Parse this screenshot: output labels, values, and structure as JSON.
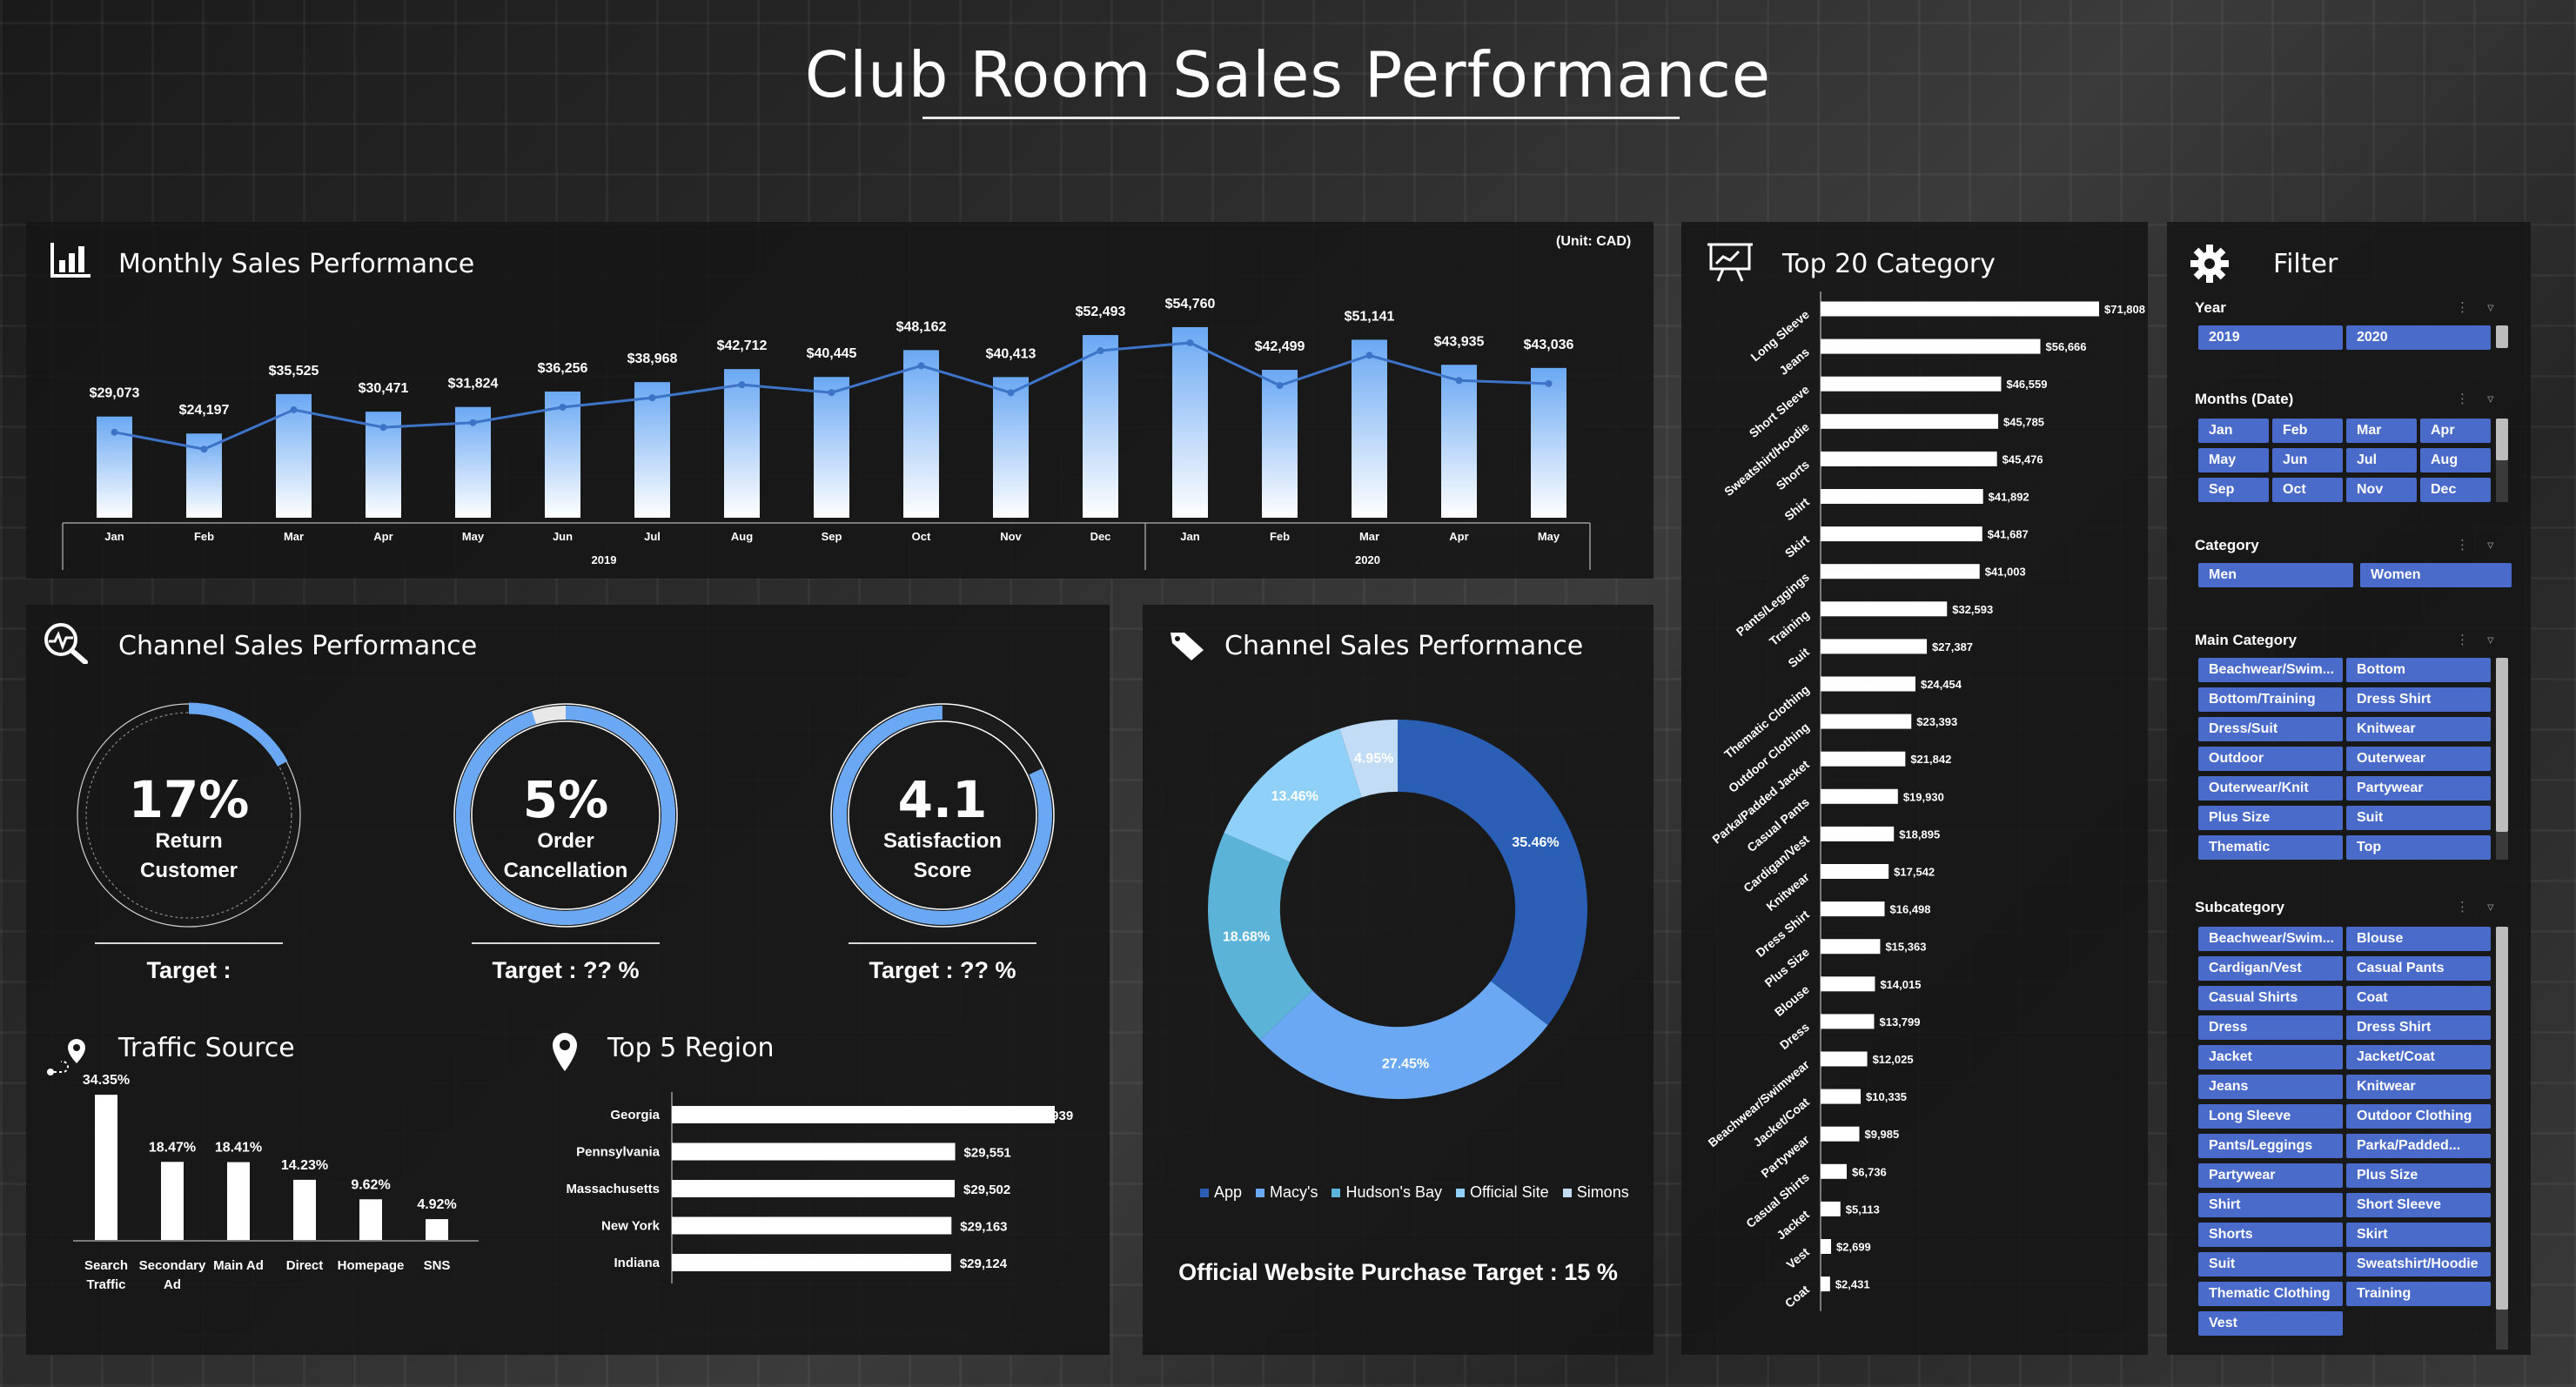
{
  "title": "Club Room Sales Performance",
  "colors": {
    "bar_light": "#ffffff",
    "bar_blue": "#6aa8f3",
    "line_blue": "#3d74c8",
    "chip": "#4a6bc9",
    "donut": [
      "#2a5fb5",
      "#6aa8f3",
      "#5bb4d8",
      "#8fd0f8",
      "#c2dcf6"
    ]
  },
  "monthly": {
    "title": "Monthly Sales Performance",
    "unit": "(Unit: CAD)",
    "icon": "bar-chart-icon"
  },
  "channel_kpi": {
    "title": "Channel Sales Performance",
    "icon": "chart-search-icon",
    "kpis": [
      {
        "big": "17%",
        "line1": "Return",
        "line2": "Customer",
        "target": "Target :",
        "fill": 0.17
      },
      {
        "big": "5%",
        "line1": "Order",
        "line2": "Cancellation",
        "target": "Target : ?? %",
        "fill": 0.95
      },
      {
        "big": "4.1",
        "line1": "Satisfaction",
        "line2": "Score",
        "target": "Target : ?? %",
        "fill": 0.82
      }
    ]
  },
  "traffic": {
    "title": "Traffic Source",
    "icon": "location-route-icon"
  },
  "region": {
    "title": "Top 5 Region",
    "icon": "map-pin-icon"
  },
  "channel_donut": {
    "title": "Channel Sales Performance",
    "icon": "tag-icon",
    "target_text": "Official Website Purchase Target : 15 %"
  },
  "top20": {
    "title": "Top 20 Category",
    "icon": "presentation-icon"
  },
  "filter": {
    "title": "Filter",
    "icon": "gear-icon",
    "year": {
      "label": "Year",
      "items": [
        "2019",
        "2020"
      ]
    },
    "months": {
      "label": "Months (Date)",
      "items": [
        "Jan",
        "Feb",
        "Mar",
        "Apr",
        "May",
        "Jun",
        "Jul",
        "Aug",
        "Sep",
        "Oct",
        "Nov",
        "Dec"
      ]
    },
    "category": {
      "label": "Category",
      "items": [
        "Men",
        "Women"
      ]
    },
    "main_category": {
      "label": "Main Category",
      "items": [
        "Beachwear/Swim...",
        "Bottom",
        "Bottom/Training",
        "Dress Shirt",
        "Dress/Suit",
        "Knitwear",
        "Outdoor",
        "Outerwear",
        "Outerwear/Knit",
        "Partywear",
        "Plus Size",
        "Suit",
        "Thematic",
        "Top"
      ]
    },
    "subcategory": {
      "label": "Subcategory",
      "items": [
        "Beachwear/Swim...",
        "Blouse",
        "Cardigan/Vest",
        "Casual Pants",
        "Casual Shirts",
        "Coat",
        "Dress",
        "Dress Shirt",
        "Jacket",
        "Jacket/Coat",
        "Jeans",
        "Knitwear",
        "Long Sleeve",
        "Outdoor Clothing",
        "Pants/Leggings",
        "Parka/Padded...",
        "Partywear",
        "Plus Size",
        "Shirt",
        "Short Sleeve",
        "Shorts",
        "Skirt",
        "Suit",
        "Sweatshirt/Hoodie",
        "Thematic Clothing",
        "Training",
        "Vest"
      ]
    }
  },
  "chart_data": [
    {
      "type": "bar",
      "title": "Monthly Sales Performance",
      "categories": [
        "Jan",
        "Feb",
        "Mar",
        "Apr",
        "May",
        "Jun",
        "Jul",
        "Aug",
        "Sep",
        "Oct",
        "Nov",
        "Dec",
        "Jan",
        "Feb",
        "Mar",
        "Apr",
        "May"
      ],
      "groups": [
        {
          "label": "2019",
          "count": 12
        },
        {
          "label": "2020",
          "count": 5
        }
      ],
      "values": [
        29073,
        24197,
        35525,
        30471,
        31824,
        36256,
        38968,
        42712,
        40445,
        48162,
        40413,
        52493,
        54760,
        42499,
        51141,
        43935,
        43036
      ],
      "labels": [
        "$29,073",
        "$24,197",
        "$35,525",
        "$30,471",
        "$31,824",
        "$36,256",
        "$38,968",
        "$42,712",
        "$40,445",
        "$48,162",
        "$40,413",
        "$52,493",
        "$54,760",
        "$42,499",
        "$51,141",
        "$43,935",
        "$43,036"
      ],
      "overlay": "line",
      "ylim": [
        0,
        60000
      ]
    },
    {
      "type": "bar",
      "title": "Traffic Source",
      "categories": [
        "Search Traffic",
        "Secondary Ad",
        "Main Ad",
        "Direct",
        "Homepage",
        "SNS"
      ],
      "category_lines": [
        [
          "Search",
          "Traffic"
        ],
        [
          "Secondary",
          "Ad"
        ],
        [
          "Main Ad"
        ],
        [
          "Direct"
        ],
        [
          "Homepage"
        ],
        [
          "SNS"
        ]
      ],
      "values": [
        34.35,
        18.47,
        18.41,
        14.23,
        9.62,
        4.92
      ],
      "labels": [
        "34.35%",
        "18.47%",
        "18.41%",
        "14.23%",
        "9.62%",
        "4.92%"
      ],
      "ylim": [
        0,
        35
      ]
    },
    {
      "type": "bar",
      "orientation": "horizontal",
      "title": "Top 5 Region",
      "categories": [
        "Georgia",
        "Pennsylvania",
        "Massachusetts",
        "New York",
        "Indiana"
      ],
      "values": [
        39939,
        29551,
        29502,
        29163,
        29124
      ],
      "labels": [
        ",939",
        "$29,551",
        "$29,502",
        "$29,163",
        "$29,124"
      ]
    },
    {
      "type": "pie",
      "title": "Channel Sales Performance",
      "categories": [
        "App",
        "Macy's",
        "Hudson's Bay",
        "Official Site",
        "Simons"
      ],
      "values": [
        35.46,
        27.45,
        18.68,
        13.46,
        4.95
      ],
      "labels": [
        "35.46%",
        "27.45%",
        "18.68%",
        "13.46%",
        "4.95%"
      ],
      "hole": 0.62
    },
    {
      "type": "bar",
      "orientation": "horizontal",
      "title": "Top 20 Category",
      "categories": [
        "Long Sleeve",
        "Jeans",
        "Short Sleeve",
        "Sweatshirt/Hoodie",
        "Shorts",
        "Shirt",
        "Skirt",
        "Pants/Leggings",
        "Training",
        "Suit",
        "Thematic Clothing",
        "Outdoor Clothing",
        "Parka/Padded Jacket",
        "Casual Pants",
        "Cardigan/Vest",
        "Knitwear",
        "Dress Shirt",
        "Plus Size",
        "Blouse",
        "Dress",
        "Beachwear/Swimwear",
        "Jacket/Coat",
        "Partywear",
        "Casual Shirts",
        "Jacket",
        "Vest",
        "Coat"
      ],
      "values": [
        71808,
        56666,
        46559,
        45785,
        45476,
        41892,
        41687,
        41003,
        32593,
        27387,
        24454,
        23393,
        21842,
        19930,
        18895,
        17542,
        16498,
        15363,
        14015,
        13799,
        12025,
        10335,
        9985,
        6736,
        5113,
        2699,
        2431
      ],
      "labels": [
        "$71,808",
        "$56,666",
        "$46,559",
        "$45,785",
        "$45,476",
        "$41,892",
        "$41,687",
        "$41,003",
        "$32,593",
        "$27,387",
        "$24,454",
        "$23,393",
        "$21,842",
        "$19,930",
        "$18,895",
        "$17,542",
        "$16,498",
        "$15,363",
        "$14,015",
        "$13,799",
        "$12,025",
        "$10,335",
        "$9,985",
        "$6,736",
        "$5,113",
        "$2,699",
        "$2,431"
      ]
    }
  ]
}
